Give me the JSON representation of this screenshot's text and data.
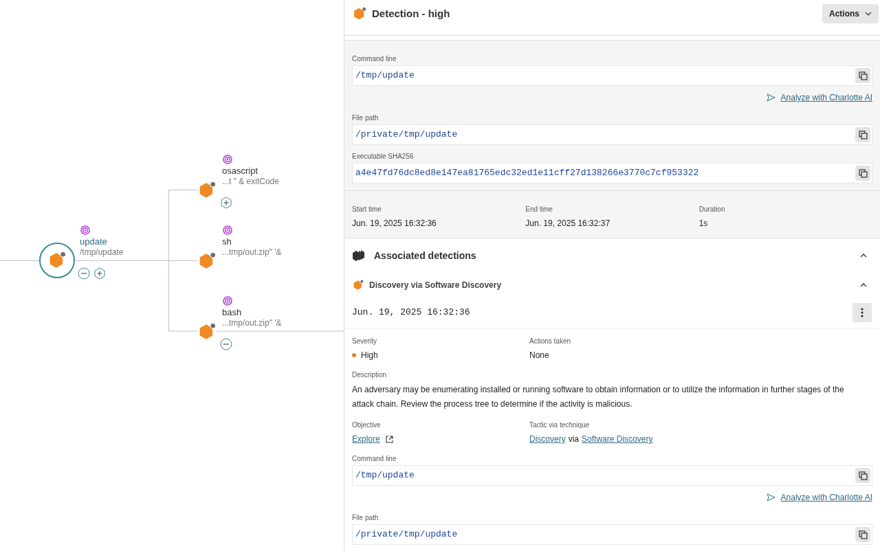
{
  "tree": {
    "nodes": [
      {
        "name": "update",
        "subtitle": "/tmp/update",
        "selected": true,
        "collapsible": true,
        "expandable": true
      },
      {
        "name": "osascript",
        "subtitle": "...t \" & exitCode",
        "selected": false,
        "expandable": true
      },
      {
        "name": "sh",
        "subtitle": "...tmp/out.zip\" '&",
        "selected": false
      },
      {
        "name": "bash",
        "subtitle": "...tmp/out.zip\" '&",
        "selected": false,
        "collapsible": true
      }
    ]
  },
  "panel": {
    "title": "Detection - high",
    "actions_button": "Actions",
    "process_fields": [
      {
        "label": "Command line",
        "value": "/tmp/update",
        "analyze_link": "Analyze with Charlotte AI"
      },
      {
        "label": "File path",
        "value": "/private/tmp/update"
      },
      {
        "label": "Executable SHA256",
        "value": "a4e47fd76dc8ed8e147ea81765edc32ed1e11cff27d138266e3770c7cf953322"
      }
    ],
    "times": [
      {
        "label": "Start time",
        "value": "Jun. 19, 2025 16:32:36"
      },
      {
        "label": "End time",
        "value": "Jun. 19, 2025 16:32:37"
      },
      {
        "label": "Duration",
        "value": "1s"
      }
    ],
    "associated": {
      "title": "Associated detections",
      "expanded": true,
      "detection": {
        "name": "Discovery via Software Discovery",
        "expanded": true,
        "timestamp": "Jun. 19, 2025 16:32:36",
        "severity": {
          "label": "Severity",
          "value": "High",
          "color": "#e8832a"
        },
        "actions_taken": {
          "label": "Actions taken",
          "value": "None"
        },
        "description": {
          "label": "Description",
          "text": "An adversary may be enumerating installed or running software to obtain information or to utilize the information in further stages of the attack chain. Review the process tree to determine if the activity is malicious."
        },
        "objective": {
          "label": "Objective",
          "link": "Explore"
        },
        "tactic": {
          "label": "Tactic via technique",
          "tactic": "Discovery",
          "via": "via",
          "technique": "Software Discovery"
        },
        "fields": [
          {
            "label": "Command line",
            "value": "/tmp/update",
            "analyze_link": "Analyze with Charlotte AI"
          },
          {
            "label": "File path",
            "value": "/private/tmp/update"
          }
        ]
      }
    }
  }
}
